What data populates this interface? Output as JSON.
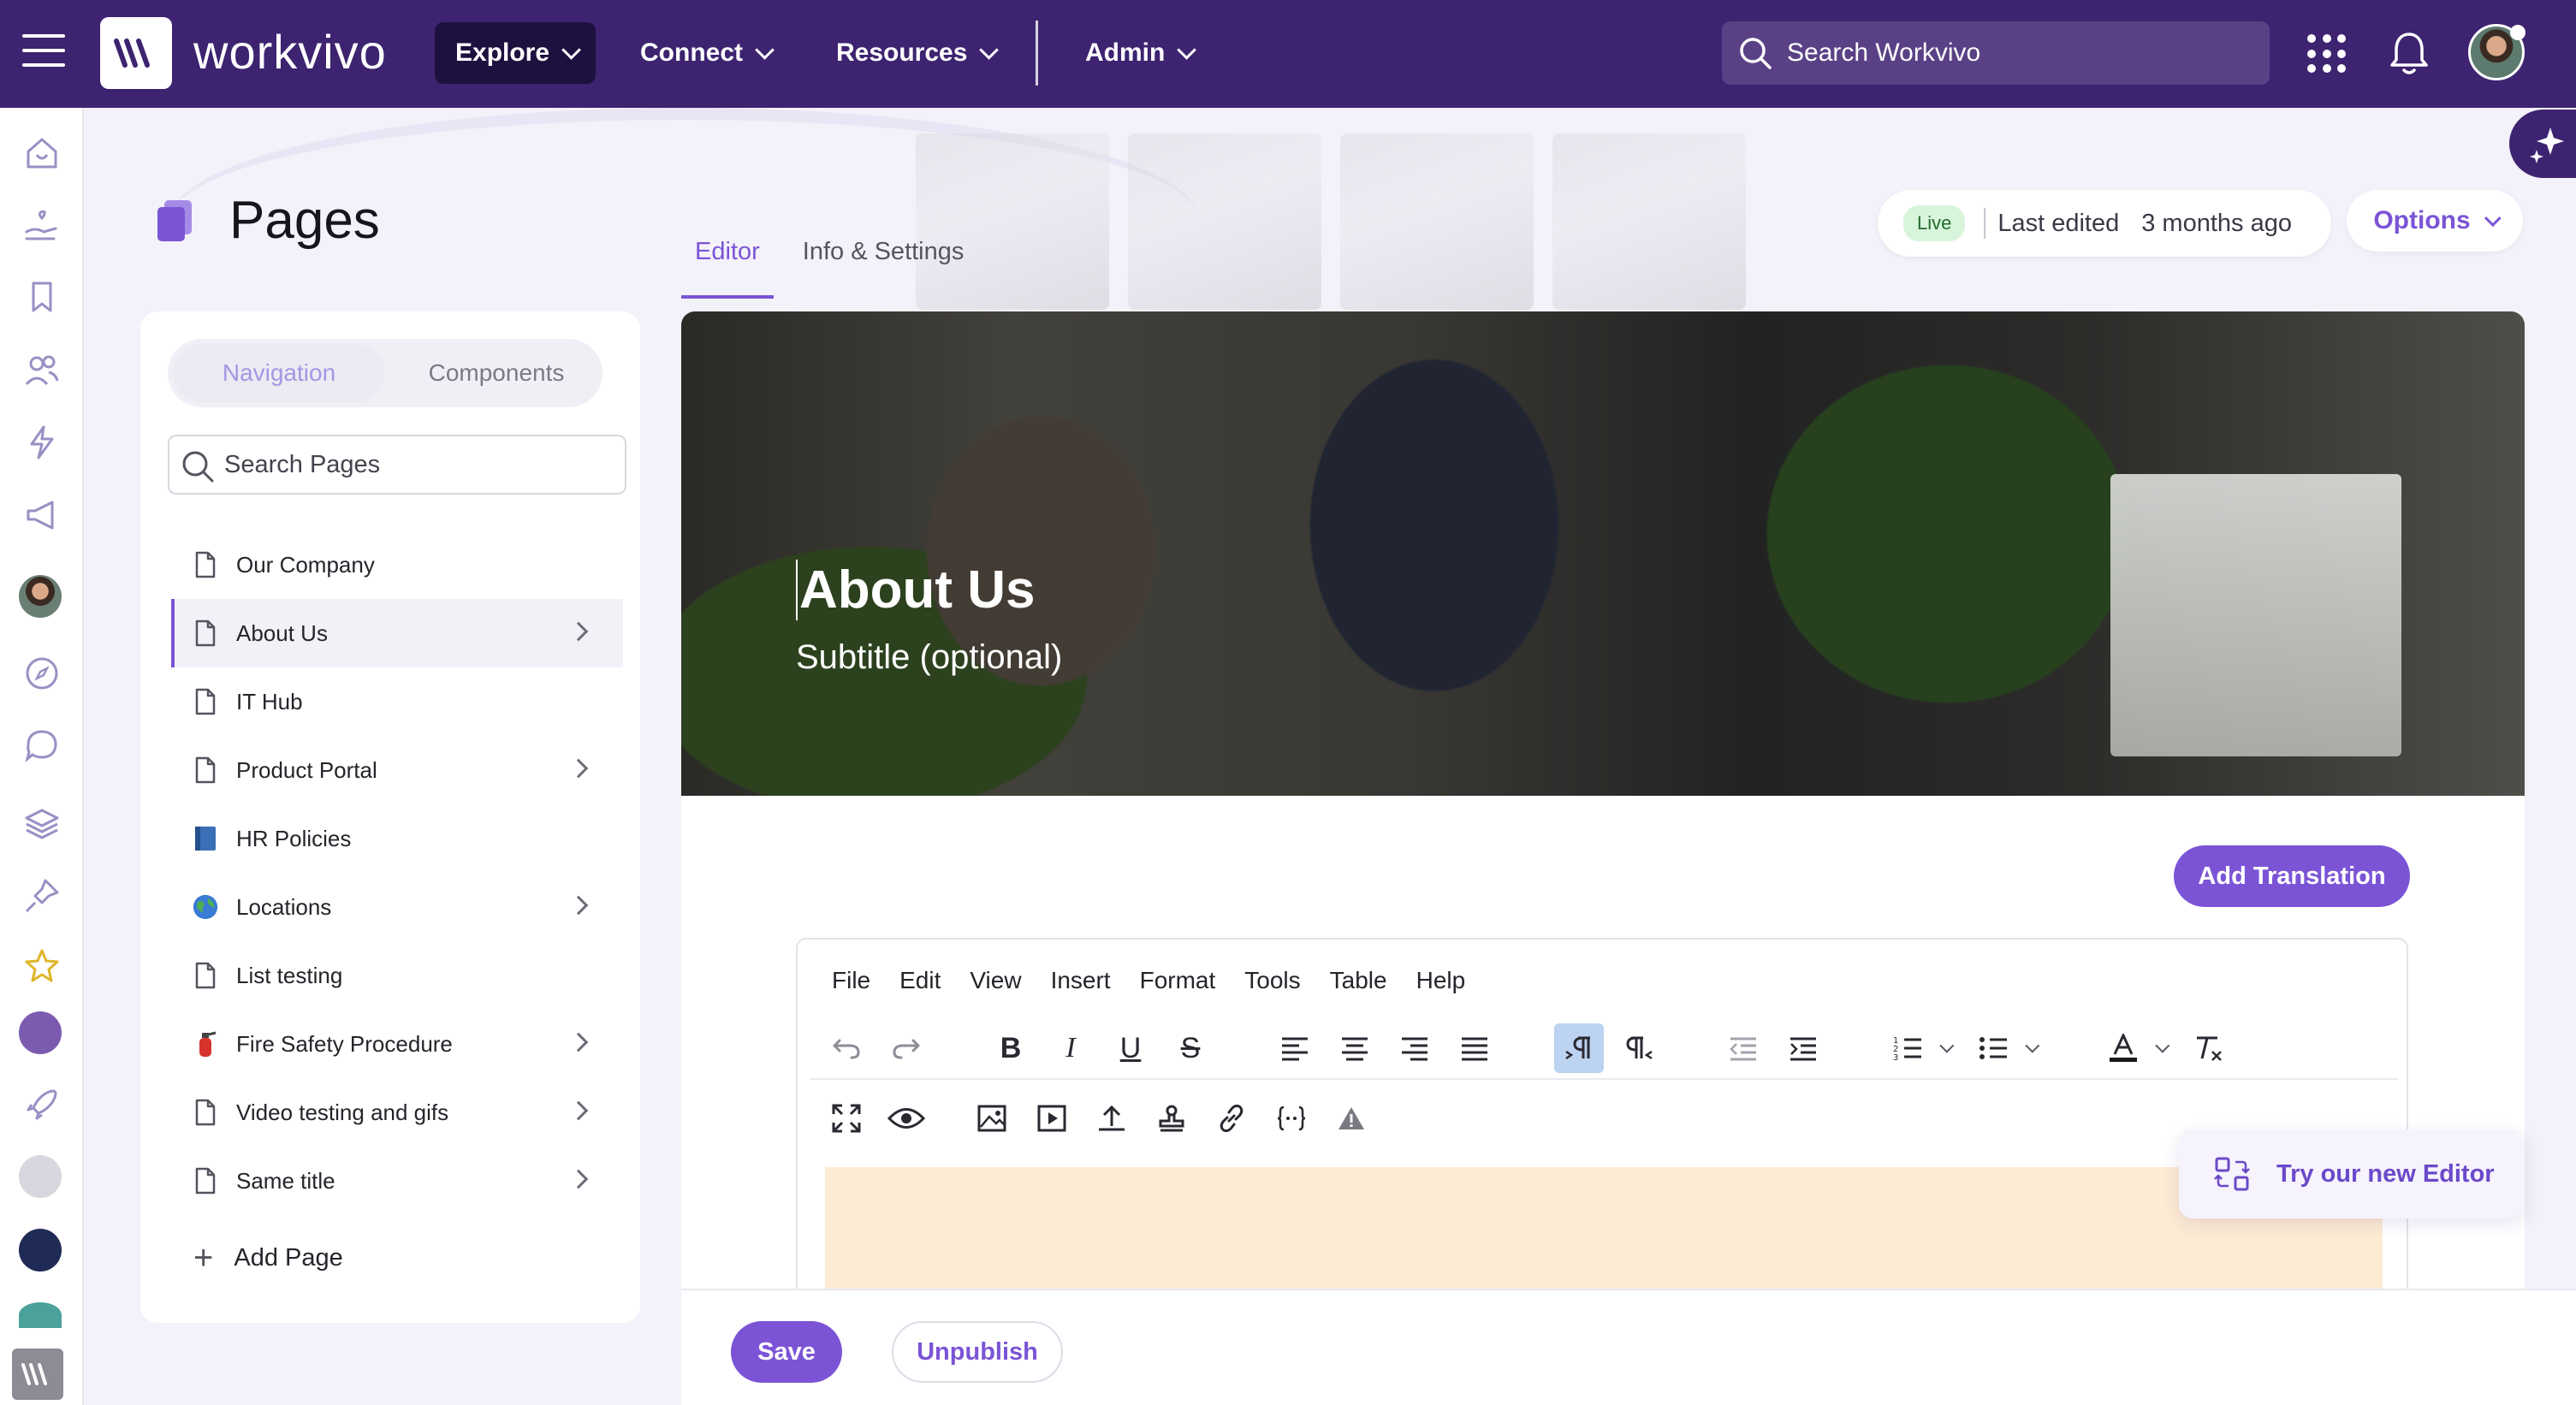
{
  "topbar": {
    "brand": "workvivo",
    "nav": [
      {
        "label": "Explore"
      },
      {
        "label": "Connect"
      },
      {
        "label": "Resources"
      },
      {
        "label": "Admin"
      }
    ],
    "search_placeholder": "Search Workvivo",
    "accent": "#3d2370"
  },
  "header": {
    "title": "Pages",
    "tabs": [
      {
        "label": "Editor",
        "active": true
      },
      {
        "label": "Info & Settings",
        "active": false
      }
    ],
    "status": {
      "badge": "Live",
      "label": "Last edited",
      "time": "3 months ago"
    },
    "options_label": "Options"
  },
  "sidebar": {
    "segments": [
      {
        "label": "Navigation",
        "active": true
      },
      {
        "label": "Components",
        "active": false
      }
    ],
    "search_placeholder": "Search Pages",
    "items": [
      {
        "label": "Our Company",
        "icon": "page-icon",
        "has_children": false
      },
      {
        "label": "About Us",
        "icon": "page-icon",
        "has_children": true,
        "active": true
      },
      {
        "label": "IT Hub",
        "icon": "page-icon",
        "has_children": false
      },
      {
        "label": "Product Portal",
        "icon": "page-icon",
        "has_children": true
      },
      {
        "label": "HR Policies",
        "icon": "book-emoji-icon",
        "has_children": false
      },
      {
        "label": "Locations",
        "icon": "globe-emoji-icon",
        "has_children": true
      },
      {
        "label": "List testing",
        "icon": "page-icon",
        "has_children": false
      },
      {
        "label": "Fire Safety Procedure",
        "icon": "fire-extinguisher-emoji-icon",
        "has_children": true
      },
      {
        "label": "Video testing and gifs",
        "icon": "page-icon",
        "has_children": true
      },
      {
        "label": "Same title",
        "icon": "page-icon",
        "has_children": true
      }
    ],
    "add_page_label": "Add Page"
  },
  "editor": {
    "banner_title": "About Us",
    "banner_subtitle": "Subtitle (optional)",
    "add_translation_label": "Add Translation",
    "menubar": [
      "File",
      "Edit",
      "View",
      "Insert",
      "Format",
      "Tools",
      "Table",
      "Help"
    ],
    "format_glyphs": {
      "bold": "B",
      "italic": "I",
      "underline": "U",
      "strike": "S"
    },
    "try_editor_label": "Try our new Editor"
  },
  "actions": {
    "save_label": "Save",
    "unpublish_label": "Unpublish",
    "primary_color": "#7b54d6"
  }
}
